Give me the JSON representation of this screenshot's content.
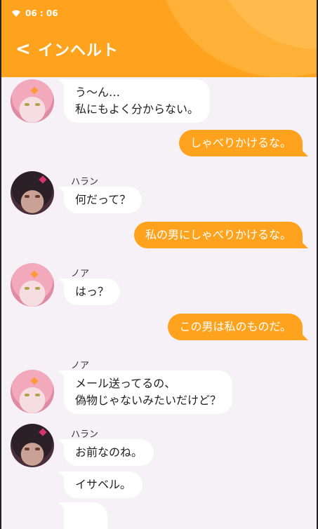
{
  "status": {
    "time": "06 : 06"
  },
  "header": {
    "back_glyph": "<",
    "title": "インヘルト"
  },
  "messages": [
    {
      "side": "left",
      "speaker": "",
      "avatar": "pink",
      "text": "う～ん…\n私にもよく分からない。"
    },
    {
      "side": "right",
      "text": "しゃべりかけるな。"
    },
    {
      "side": "left",
      "speaker": "ハラン",
      "avatar": "dark",
      "text": "何だって？"
    },
    {
      "side": "right",
      "text": "私の男にしゃべりかけるな。"
    },
    {
      "side": "left",
      "speaker": "ノア",
      "avatar": "pink",
      "text": "はっ？"
    },
    {
      "side": "right",
      "text": "この男は私のものだ。"
    },
    {
      "side": "left",
      "speaker": "ノア",
      "avatar": "pink",
      "text": "メール送ってるの、\n偽物じゃないみたいだけど？"
    },
    {
      "side": "left",
      "speaker": "ハラン",
      "avatar": "dark",
      "text": "お前なのね。"
    },
    {
      "side": "left",
      "speaker": "",
      "avatar": "",
      "text": "イサベル。"
    },
    {
      "side": "left",
      "speaker": "",
      "avatar": "",
      "text": "…",
      "typing": true
    }
  ],
  "colors": {
    "accent": "#ffa31f",
    "background": "#f6f1f6",
    "bubble_left": "#ffffff"
  },
  "icons": {
    "status_wifi": "wifi-icon",
    "back": "chevron-left-icon",
    "typing_cursor": "cursor-triangle-icon"
  }
}
